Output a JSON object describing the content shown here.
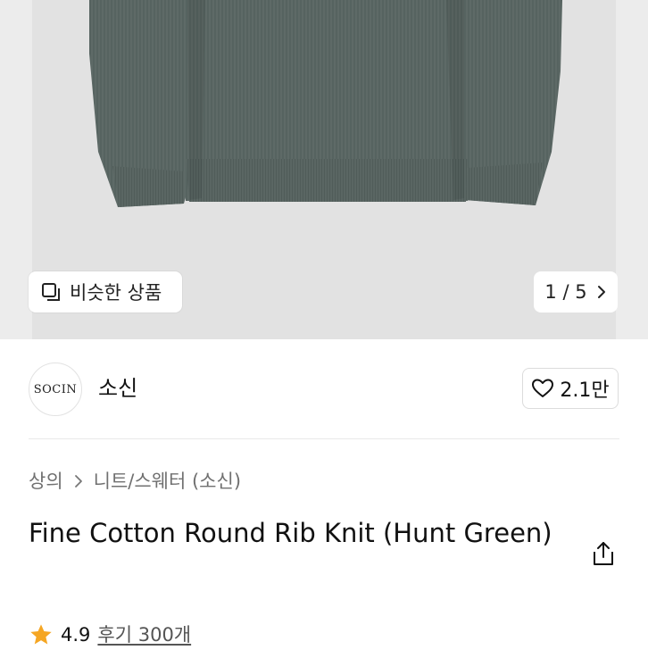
{
  "hero": {
    "similar_label": "비슷한 상품",
    "counter": "1 / 5",
    "icons": [
      "similar-items-icon",
      "chevron-right-icon"
    ]
  },
  "brand": {
    "logo_text": "SOCIN",
    "name": "소신",
    "likes": "2.1만"
  },
  "breadcrumb": {
    "items": [
      "상의",
      "니트/스웨터 (소신)"
    ]
  },
  "product": {
    "title": "Fine Cotton Round Rib Knit (Hunt Green)",
    "rating": "4.9",
    "reviews": "후기 300개"
  },
  "colors": {
    "star": "#f5a623",
    "hero_bg": "#e2e2e2",
    "sweater": "#5d6966"
  }
}
